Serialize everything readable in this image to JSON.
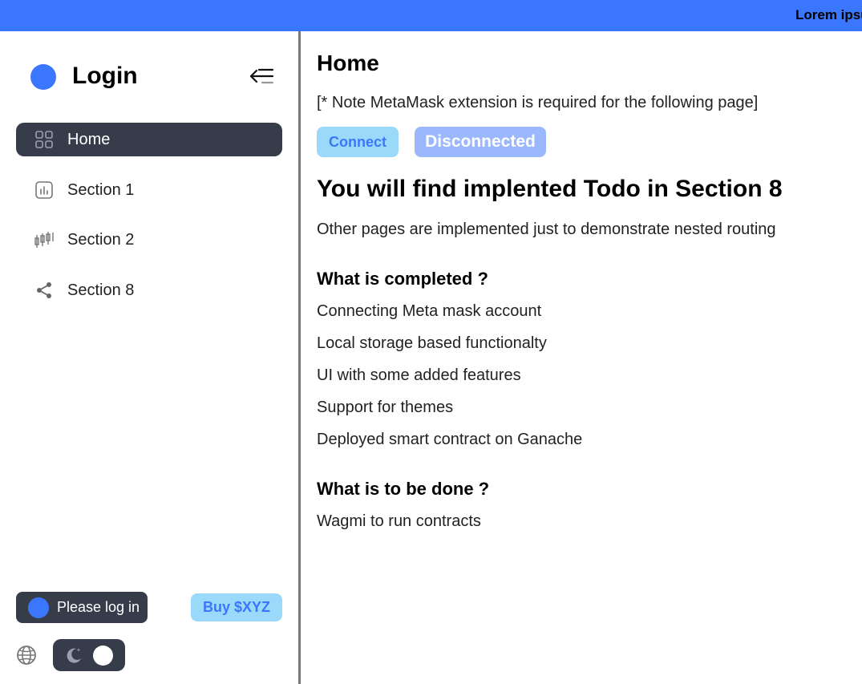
{
  "topbar": {
    "marquee_text": "Lorem ipsum"
  },
  "sidebar": {
    "brand_title": "Login",
    "items": [
      {
        "label": "Home",
        "icon": "grid-icon",
        "active": true
      },
      {
        "label": "Section 1",
        "icon": "chart-icon",
        "active": false
      },
      {
        "label": "Section 2",
        "icon": "candlestick-icon",
        "active": false
      },
      {
        "label": "Section 8",
        "icon": "share-icon",
        "active": false
      }
    ],
    "login_label": "Please log in",
    "buy_label": "Buy $XYZ"
  },
  "main": {
    "title": "Home",
    "note": "[* Note MetaMask extension is required for the following page]",
    "connect_label": "Connect",
    "status_label": "Disconnected",
    "headline": "You will find implented Todo in Section 8",
    "subtext": "Other pages are implemented just to demonstrate nested routing",
    "completed_heading": "What is completed ?",
    "completed_items": [
      "Connecting Meta mask account",
      "Local storage based functionalty",
      "UI with some added features",
      "Support for themes",
      "Deployed smart contract on Ganache"
    ],
    "todo_heading": "What is to be done ?",
    "todo_items": [
      "Wagmi to run contracts"
    ]
  },
  "colors": {
    "accent": "#3b76ff",
    "dark": "#373c4b",
    "light_blue": "#9bd9fb",
    "disconnected_bg": "#9bb8ff"
  }
}
